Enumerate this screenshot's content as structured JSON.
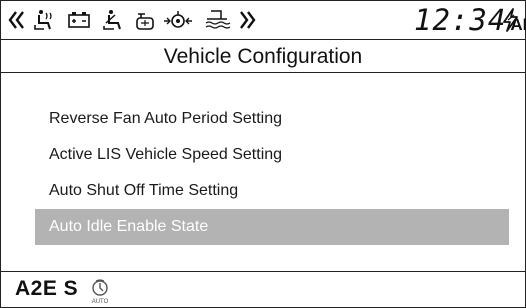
{
  "status_bar": {
    "icons": [
      "chevron-left-icon",
      "seat-heater-icon",
      "battery-icon",
      "seatbelt-driver-icon",
      "oil-can-icon",
      "engine-warning-icon",
      "fuel-filter-water-icon",
      "chevron-right-icon"
    ],
    "clock_time": "12:34",
    "clock_ampm": "AM",
    "power_icon": "lightning-bolt-icon"
  },
  "title": "Vehicle Configuration",
  "menu": {
    "items": [
      {
        "label": "Reverse Fan Auto Period Setting",
        "selected": false
      },
      {
        "label": "Active LIS Vehicle Speed Setting",
        "selected": false
      },
      {
        "label": "Auto Shut Off Time Setting",
        "selected": false
      },
      {
        "label": "Auto Idle Enable State",
        "selected": true
      }
    ]
  },
  "footer": {
    "code": "A2E S",
    "icon": "auto-idle-icon",
    "icon_caption": "AUTO"
  },
  "colors": {
    "selected_row_bg": "#b3b3b3",
    "selected_row_text": "#ffffff",
    "border": "#222222"
  }
}
